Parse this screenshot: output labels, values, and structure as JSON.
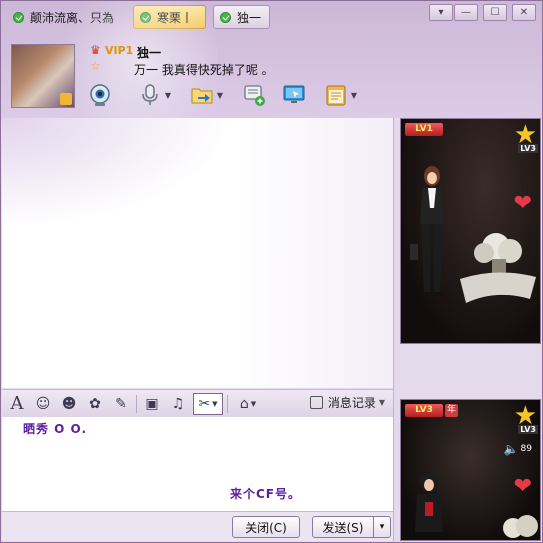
{
  "tabs": [
    {
      "label": "颠沛流离、只為",
      "active": false
    },
    {
      "label": "寒栗丨",
      "active": true
    },
    {
      "label": "独一",
      "active": false
    }
  ],
  "window_controls": {
    "menu": "▾",
    "minimize": "—",
    "maximize": "☐",
    "close": "✕"
  },
  "contact": {
    "vip_label": "VIP1",
    "nickname": "独一",
    "signature": "万一 我真得快死掉了呢 。"
  },
  "toolbar": {
    "video_icon": "video-call-icon",
    "voice_icon": "voice-call-icon",
    "file_icon": "send-file-icon",
    "group_chat_icon": "add-chat-icon",
    "remote_icon": "remote-assist-icon",
    "apps_icon": "apps-menu-icon"
  },
  "format_bar": {
    "history_label": "消息记录",
    "icons": [
      "font-icon",
      "emoji-icon",
      "magic-face-icon",
      "sticker-icon",
      "scribble-icon",
      "image-icon",
      "music-icon",
      "screenshot-icon",
      "more-tools-icon"
    ]
  },
  "input": {
    "line1": "晒秀 O O.",
    "line2": "来个CF号。"
  },
  "buttons": {
    "close": "关闭(C)",
    "send": "发送(S)",
    "send_dropdown": "▾"
  },
  "show_panels": [
    {
      "level": "LV1",
      "star_level": "LV3",
      "year_badge": ""
    },
    {
      "level": "LV3",
      "star_level": "LV3",
      "year_badge": "年",
      "volume": "89"
    }
  ],
  "colors": {
    "accent": "#f3c85f",
    "frame": "#cdb7d8",
    "input_text": "#5a1fa3"
  }
}
